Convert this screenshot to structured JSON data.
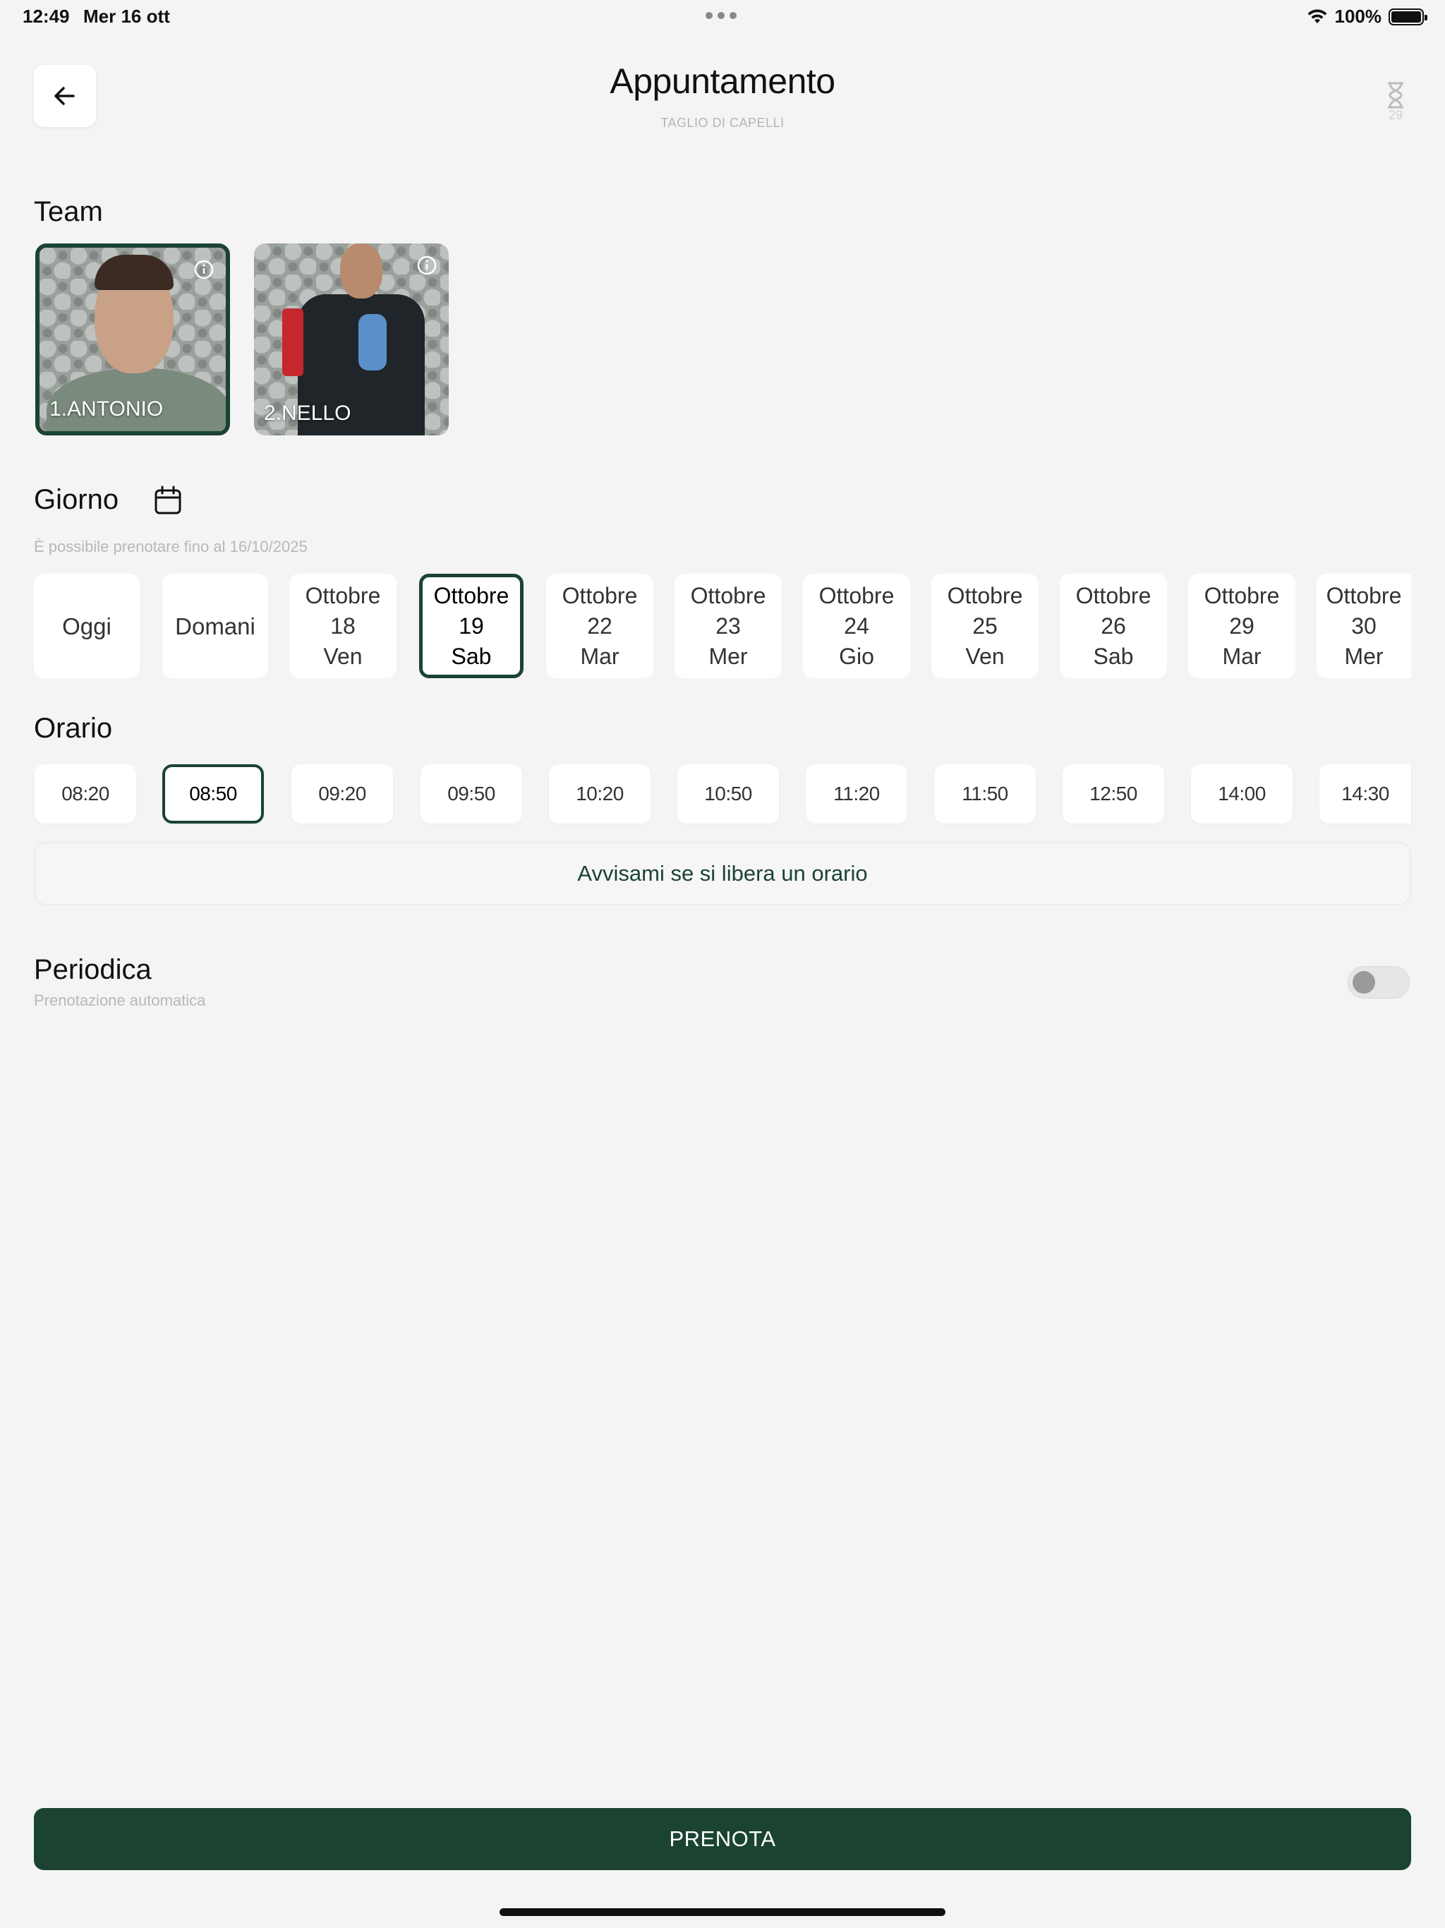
{
  "status_bar": {
    "time": "12:49",
    "date": "Mer 16 ott",
    "battery": "100%",
    "battery_level": 1.0
  },
  "header": {
    "title": "Appuntamento",
    "subtitle": "TAGLIO DI CAPELLI",
    "timer_count": "29"
  },
  "team": {
    "title": "Team",
    "members": [
      {
        "name": "1.ANTONIO",
        "selected": true
      },
      {
        "name": "2.NELLO",
        "selected": false
      }
    ]
  },
  "giorno": {
    "title": "Giorno",
    "hint": "È possibile prenotare fino al 16/10/2025",
    "days": [
      {
        "label": "Oggi"
      },
      {
        "label": "Domani"
      },
      {
        "month": "Ottobre",
        "day": "18",
        "weekday": "Ven"
      },
      {
        "month": "Ottobre",
        "day": "19",
        "weekday": "Sab",
        "selected": true
      },
      {
        "month": "Ottobre",
        "day": "22",
        "weekday": "Mar"
      },
      {
        "month": "Ottobre",
        "day": "23",
        "weekday": "Mer"
      },
      {
        "month": "Ottobre",
        "day": "24",
        "weekday": "Gio"
      },
      {
        "month": "Ottobre",
        "day": "25",
        "weekday": "Ven"
      },
      {
        "month": "Ottobre",
        "day": "26",
        "weekday": "Sab"
      },
      {
        "month": "Ottobre",
        "day": "29",
        "weekday": "Mar"
      },
      {
        "month": "Ottobre",
        "day": "30",
        "weekday": "Mer"
      }
    ]
  },
  "orario": {
    "title": "Orario",
    "times": [
      "08:20",
      "08:50",
      "09:20",
      "09:50",
      "10:20",
      "10:50",
      "11:20",
      "11:50",
      "12:50",
      "14:00",
      "14:30"
    ],
    "selected_time": "08:50",
    "notify_label": "Avvisami se si libera un orario"
  },
  "periodica": {
    "title": "Periodica",
    "subtitle": "Prenotazione automatica",
    "enabled": false
  },
  "actions": {
    "book_label": "PRENOTA"
  },
  "colors": {
    "accent": "#1b4332",
    "background": "#f4f4f4"
  }
}
